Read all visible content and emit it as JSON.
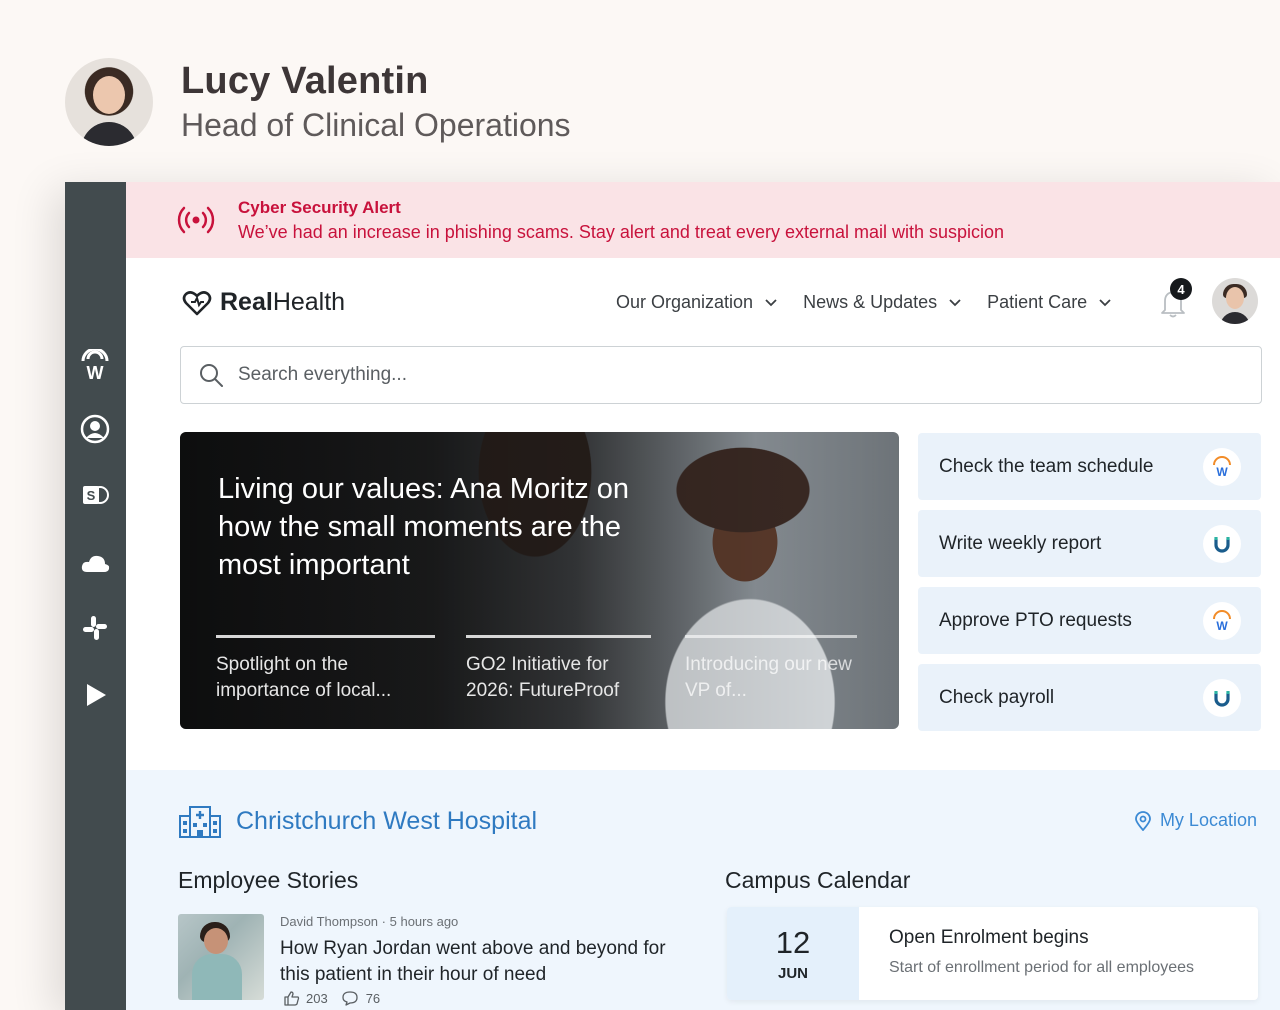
{
  "profile": {
    "name": "Lucy Valentin",
    "role": "Head of Clinical Operations"
  },
  "rail": {
    "icons": [
      "workvivo-icon",
      "user-circle-icon",
      "sharepoint-icon",
      "cloud-icon",
      "slack-icon",
      "play-icon"
    ]
  },
  "alert": {
    "title": "Cyber Security Alert",
    "message": "We’ve had an increase in phishing scams. Stay alert and treat every external mail with suspicion",
    "color": "#c8123c"
  },
  "header": {
    "logo_bold": "Real",
    "logo_regular": "Health",
    "nav": [
      {
        "label": "Our Organization"
      },
      {
        "label": "News & Updates"
      },
      {
        "label": "Patient Care"
      }
    ],
    "notification_count": "4"
  },
  "search": {
    "placeholder": "Search everything..."
  },
  "hero": {
    "title": "Living our values: Ana Moritz on how the small moments are the most important",
    "tabs": [
      {
        "label": "Spotlight on the importance of local..."
      },
      {
        "label": "GO2 Initiative for 2026: FutureProof"
      },
      {
        "label": "Introducing our new VP of..."
      }
    ]
  },
  "quick_actions": [
    {
      "label": "Check the team schedule",
      "icon": "workvivo-icon"
    },
    {
      "label": "Write weekly report",
      "icon": "magnet-icon"
    },
    {
      "label": "Approve PTO requests",
      "icon": "workvivo-icon"
    },
    {
      "label": "Check payroll",
      "icon": "magnet-icon"
    }
  ],
  "location": {
    "hospital": "Christchurch West Hospital",
    "my_location": "My Location",
    "accent": "#2f7ac1"
  },
  "stories": {
    "title": "Employee Stories",
    "items": [
      {
        "author": "David Thompson",
        "time": "5 hours ago",
        "title": "How Ryan Jordan went above and beyond for this patient in their hour of need",
        "likes": "203",
        "comments": "76"
      }
    ]
  },
  "calendar": {
    "title": "Campus Calendar",
    "events": [
      {
        "day": "12",
        "month": "JUN",
        "title": "Open Enrolment begins",
        "subtitle": "Start of enrollment period for all employees"
      }
    ]
  }
}
